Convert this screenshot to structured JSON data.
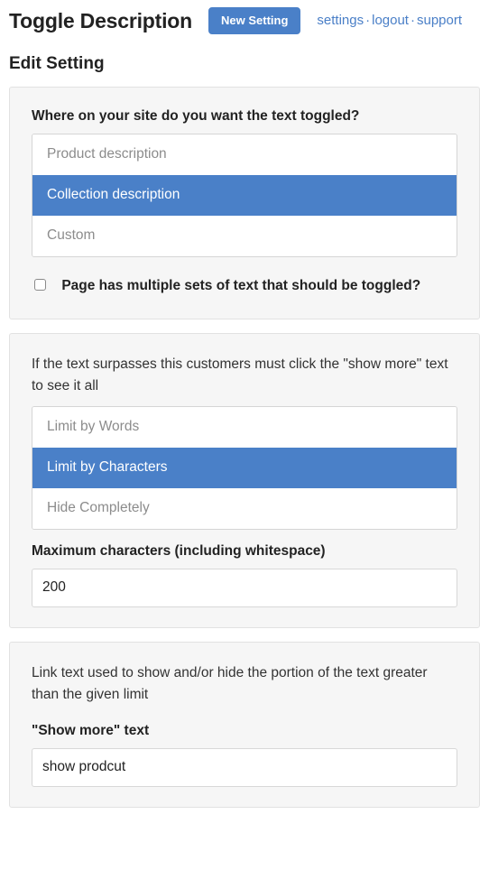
{
  "header": {
    "app_title": "Toggle Description",
    "new_setting_button": "New Setting",
    "links": [
      {
        "label": "settings"
      },
      {
        "label": "logout"
      },
      {
        "label": "support"
      }
    ],
    "link_separator": "·"
  },
  "page_heading": "Edit Setting",
  "panels": [
    {
      "label": "Where on your site do you want the text toggled?",
      "options": [
        {
          "label": "Product description",
          "selected": false
        },
        {
          "label": "Collection description",
          "selected": true
        },
        {
          "label": "Custom",
          "selected": false
        }
      ],
      "checkbox": {
        "label": "Page has multiple sets of text that should be toggled?",
        "checked": false
      }
    },
    {
      "description": "If the text surpasses this customers must click the \"show more\" text to see it all",
      "options": [
        {
          "label": "Limit by Words",
          "selected": false
        },
        {
          "label": "Limit by Characters",
          "selected": true
        },
        {
          "label": "Hide Completely",
          "selected": false
        }
      ],
      "input_label": "Maximum characters (including whitespace)",
      "input_value": "200",
      "input_placeholder": ""
    },
    {
      "description": "Link text used to show and/or hide the portion of the text greater than the given limit",
      "input_label": "\"Show more\" text",
      "input_value": "show prodcut",
      "input_placeholder": ""
    }
  ],
  "colors": {
    "accent_blue": "#4a80c8",
    "link_blue": "#4a7fc7",
    "panel_bg": "#f6f6f6",
    "panel_border": "#e2e2e2",
    "input_border": "#d8d8d8",
    "muted_text": "#8c8c8c"
  }
}
